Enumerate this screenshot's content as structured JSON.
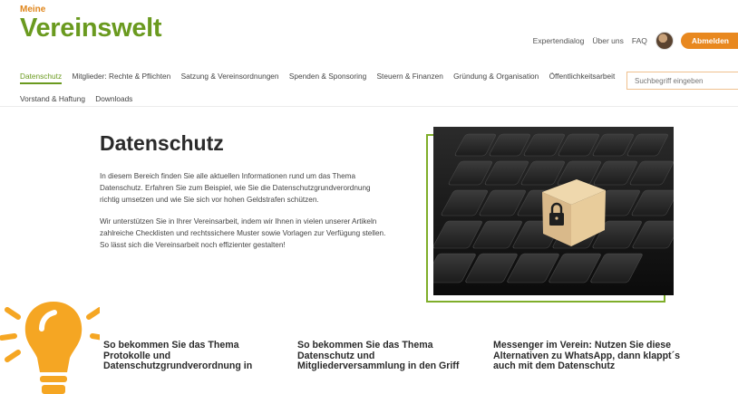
{
  "logo": {
    "small": "Meine",
    "big": "Vereinswelt"
  },
  "header": {
    "links": [
      "Expertendialog",
      "Über uns",
      "FAQ"
    ],
    "logout_label": "Abmelden"
  },
  "nav": {
    "items": [
      "Datenschutz",
      "Mitglieder: Rechte & Pflichten",
      "Satzung & Vereinsordnungen",
      "Spenden & Sponsoring",
      "Steuern & Finanzen",
      "Gründung & Organisation",
      "Öffentlichkeitsarbeit",
      "Vorstand & Haftung",
      "Downloads"
    ],
    "active": "Datenschutz"
  },
  "search": {
    "placeholder": "Suchbegriff eingeben"
  },
  "main": {
    "title": "Datenschutz",
    "paragraphs": [
      "In diesem Bereich finden Sie alle aktuellen Informationen rund um das Thema Datenschutz. Erfahren Sie zum Beispiel, wie Sie die Datenschutzgrundverordnung richtig umsetzen und wie Sie sich vor hohen Geldstrafen schützen.",
      "Wir unterstützen Sie in Ihrer Vereinsarbeit, indem wir Ihnen in vielen unserer Artikeln zahlreiche Checklisten und rechtssichere Muster sowie Vorlagen zur Verfügung stellen. So lässt sich die Vereinsarbeit noch effizienter gestalten!"
    ]
  },
  "cards": [
    {
      "title": "So bekommen Sie das Thema Protokolle und Datenschutzgrundverordnung in"
    },
    {
      "title": "So bekommen Sie das Thema Datenschutz und Mitgliederversammlung in den Griff"
    },
    {
      "title": "Messenger im Verein: Nutzen Sie diese Alternativen zu WhatsApp, dann klappt´s auch mit dem Datenschutz"
    }
  ],
  "colors": {
    "brand_green": "#6a9a1f",
    "accent_orange": "#e8881f",
    "bulb_orange": "#f5a623"
  },
  "icons": [
    "search-icon",
    "lightbulb-icon",
    "padlock-icon"
  ]
}
